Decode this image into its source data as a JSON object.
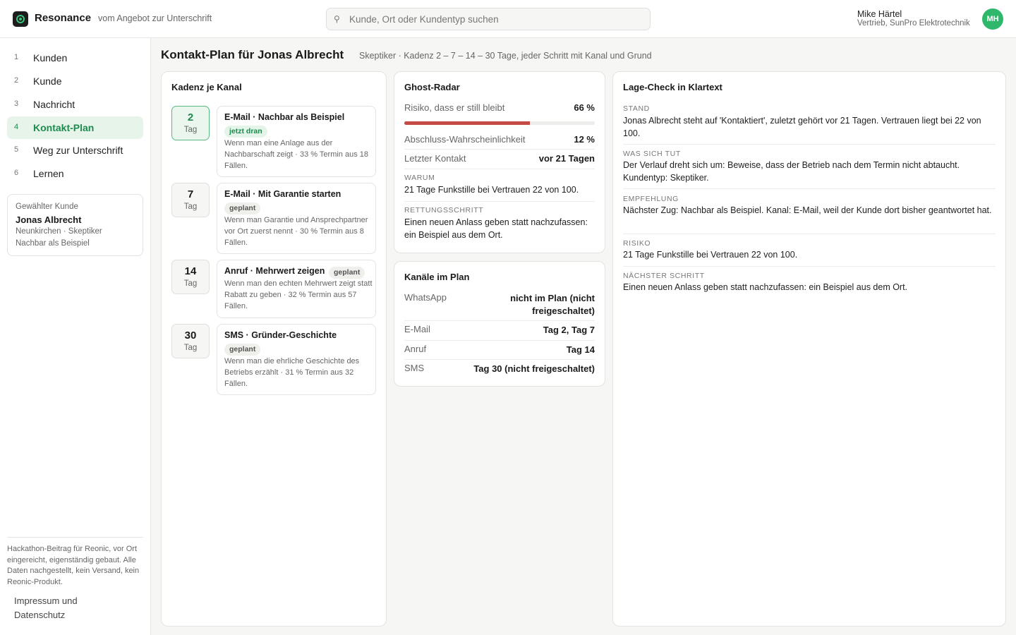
{
  "app": {
    "brand": "Resonance",
    "tagline": "vom Angebot zur Unterschrift"
  },
  "search": {
    "placeholder": "Kunde, Ort oder Kundentyp suchen"
  },
  "user": {
    "name": "Mike Härtel",
    "role": "Vertrieb, SunPro Elektrotechnik",
    "initials": "MH"
  },
  "nav": {
    "items": [
      {
        "num": "1",
        "label": "Kunden"
      },
      {
        "num": "2",
        "label": "Kunde"
      },
      {
        "num": "3",
        "label": "Nachricht"
      },
      {
        "num": "4",
        "label": "Kontakt-Plan"
      },
      {
        "num": "5",
        "label": "Weg zur Unterschrift"
      },
      {
        "num": "6",
        "label": "Lernen"
      }
    ],
    "active_index": 3
  },
  "selected_customer": {
    "title": "Gewählter Kunde",
    "name": "Jonas Albrecht",
    "meta1": "Neunkirchen · Skeptiker",
    "meta2": "Nachbar als Beispiel"
  },
  "sidebar_footer": {
    "note": "Hackathon-Beitrag für Reonic, vor Ort eingereicht, eigenständig gebaut. Alle Daten nachgestellt, kein Versand, kein Reonic-Produkt.",
    "link": "Impressum und Datenschutz"
  },
  "page": {
    "title": "Kontakt-Plan für Jonas Albrecht",
    "subtitle": "Skeptiker · Kadenz 2 – 7 – 14 – 30 Tage, jeder Schritt mit Kanal und Grund"
  },
  "cadence": {
    "title": "Kadenz je Kanal",
    "day_unit": "Tag",
    "steps": [
      {
        "day": "2",
        "title": "E-Mail · Nachbar als Beispiel",
        "badge": "jetzt dran",
        "desc": "Wenn man eine Anlage aus der Nachbarschaft zeigt · 33 % Termin aus 18 Fällen."
      },
      {
        "day": "7",
        "title": "E-Mail · Mit Garantie starten",
        "badge": "geplant",
        "desc": "Wenn man Garantie und Ansprechpartner vor Ort zuerst nennt · 30 % Termin aus 8 Fällen."
      },
      {
        "day": "14",
        "title": "Anruf · Mehrwert zeigen",
        "badge": "geplant",
        "desc": "Wenn man den echten Mehrwert zeigt statt Rabatt zu geben · 32 % Termin aus 57 Fällen."
      },
      {
        "day": "30",
        "title": "SMS · Gründer-Geschichte",
        "badge": "geplant",
        "desc": "Wenn man die ehrliche Geschichte des Betriebs erzählt · 31 % Termin aus 32 Fällen."
      }
    ]
  },
  "ghost": {
    "title": "Ghost-Radar",
    "risk_label": "Risiko, dass er still bleibt",
    "risk_value": "66 %",
    "risk_fraction": 0.66,
    "risk_color": "#c44a45",
    "close_label": "Abschluss-Wahrscheinlichkeit",
    "close_value": "12 %",
    "last_label": "Letzter Kontakt",
    "last_value": "vor 21 Tagen",
    "why_caption": "Warum",
    "why_text": "21 Tage Funkstille bei Vertrauen 22 von 100.",
    "rescue_caption": "Rettungsschritt",
    "rescue_text": "Einen neuen Anlass geben statt nachzufassen: ein Beispiel aus dem Ort."
  },
  "channels": {
    "title": "Kanäle im Plan",
    "rows": [
      {
        "k": "WhatsApp",
        "v": "nicht im Plan (nicht freigeschaltet)"
      },
      {
        "k": "E-Mail",
        "v": "Tag 2, Tag 7"
      },
      {
        "k": "Anruf",
        "v": "Tag 14"
      },
      {
        "k": "SMS",
        "v": "Tag 30 (nicht freigeschaltet)"
      }
    ]
  },
  "lage": {
    "title": "Lage-Check in Klartext",
    "sections": [
      {
        "cap": "STAND",
        "text": "Jonas Albrecht steht auf 'Kontaktiert', zuletzt gehört vor 21 Tagen. Vertrauen liegt bei 22 von 100."
      },
      {
        "cap": "WAS SICH TUT",
        "text": "Der Verlauf dreht sich um: Beweise, dass der Betrieb nach dem Termin nicht abtaucht. Kundentyp: Skeptiker."
      },
      {
        "cap": "EMPFEHLUNG",
        "text": "Nächster Zug: Nachbar als Beispiel. Kanal: E-Mail, weil der Kunde dort bisher geantwortet hat."
      },
      {
        "cap": "RISIKO",
        "text": "21 Tage Funkstille bei Vertrauen 22 von 100."
      },
      {
        "cap": "NÄCHSTER SCHRITT",
        "text": "Einen neuen Anlass geben statt nachzufassen: ein Beispiel aus dem Ort."
      }
    ]
  },
  "colors": {
    "accent": "#1e8a4e",
    "avatar": "#2fb86b",
    "risk": "#c44a45"
  }
}
